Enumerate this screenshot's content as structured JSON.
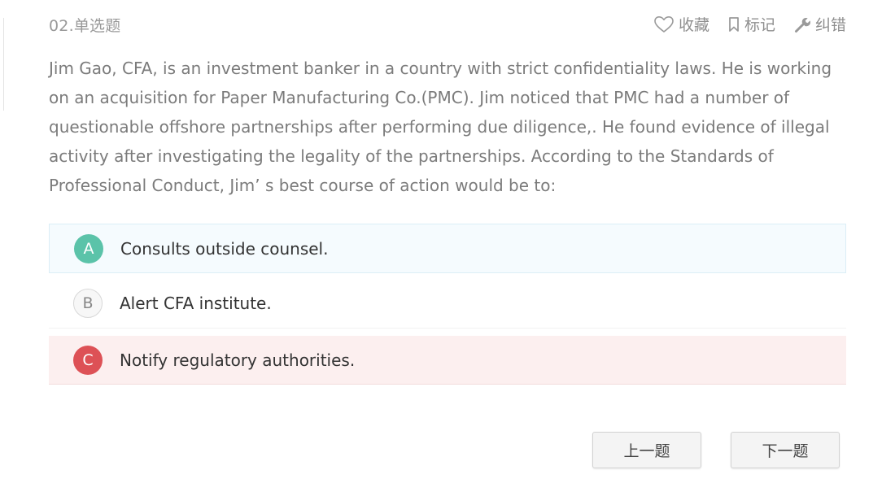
{
  "question": {
    "number_label": "02.单选题",
    "stem": "Jim Gao, CFA, is an investment banker in a country with strict confidentiality laws. He is working on an acquisition for Paper Manufacturing Co.(PMC). Jim noticed that PMC had a number of questionable offshore partnerships after performing due diligence,. He found evidence of illegal activity after investigating the legality of the partnerships. According to the Standards of Professional Conduct, Jim’ s best course of action would be to:"
  },
  "actions": {
    "favorite": {
      "label": "收藏",
      "icon": "heart-icon"
    },
    "bookmark": {
      "label": "标记",
      "icon": "bookmark-icon"
    },
    "report": {
      "label": "纠错",
      "icon": "wrench-icon"
    }
  },
  "options": [
    {
      "letter": "A",
      "text": "Consults outside counsel.",
      "state": "correct",
      "color": "#5bc3a9"
    },
    {
      "letter": "B",
      "text": "Alert CFA institute.",
      "state": "neutral",
      "color": "#f7f7f7"
    },
    {
      "letter": "C",
      "text": "Notify regulatory authorities.",
      "state": "wrong",
      "color": "#dd5156"
    }
  ],
  "navigation": {
    "prev_label": "上一题",
    "next_label": "下一题"
  }
}
